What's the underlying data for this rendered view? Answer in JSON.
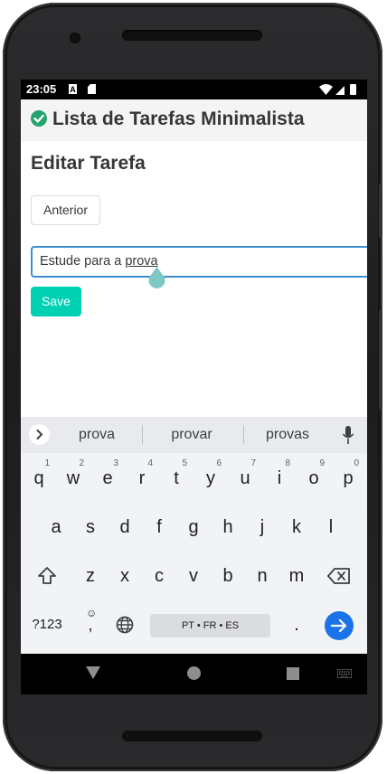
{
  "status": {
    "time": "23:05"
  },
  "app": {
    "title": "Lista de Tarefas Minimalista"
  },
  "page": {
    "title": "Editar Tarefa"
  },
  "buttons": {
    "previous": "Anterior",
    "save": "Save"
  },
  "input": {
    "value_start": "Estude para a ",
    "value_word": "prova"
  },
  "keyboard": {
    "suggestions": [
      "prova",
      "provar",
      "provas"
    ],
    "row1": [
      {
        "k": "q",
        "h": "1"
      },
      {
        "k": "w",
        "h": "2"
      },
      {
        "k": "e",
        "h": "3"
      },
      {
        "k": "r",
        "h": "4"
      },
      {
        "k": "t",
        "h": "5"
      },
      {
        "k": "y",
        "h": "6"
      },
      {
        "k": "u",
        "h": "7"
      },
      {
        "k": "i",
        "h": "8"
      },
      {
        "k": "o",
        "h": "9"
      },
      {
        "k": "p",
        "h": "0"
      }
    ],
    "row2": [
      "a",
      "s",
      "d",
      "f",
      "g",
      "h",
      "j",
      "k",
      "l"
    ],
    "row3": [
      "z",
      "x",
      "c",
      "v",
      "b",
      "n",
      "m"
    ],
    "symbols_label": "?123",
    "comma_label": ",",
    "period_label": ".",
    "space_label": "PT • FR • ES"
  },
  "colors": {
    "save_bg": "#00d1b2",
    "input_border": "#3e8ed0",
    "enter_bg": "#1a73e8",
    "check": "#23a46d"
  }
}
